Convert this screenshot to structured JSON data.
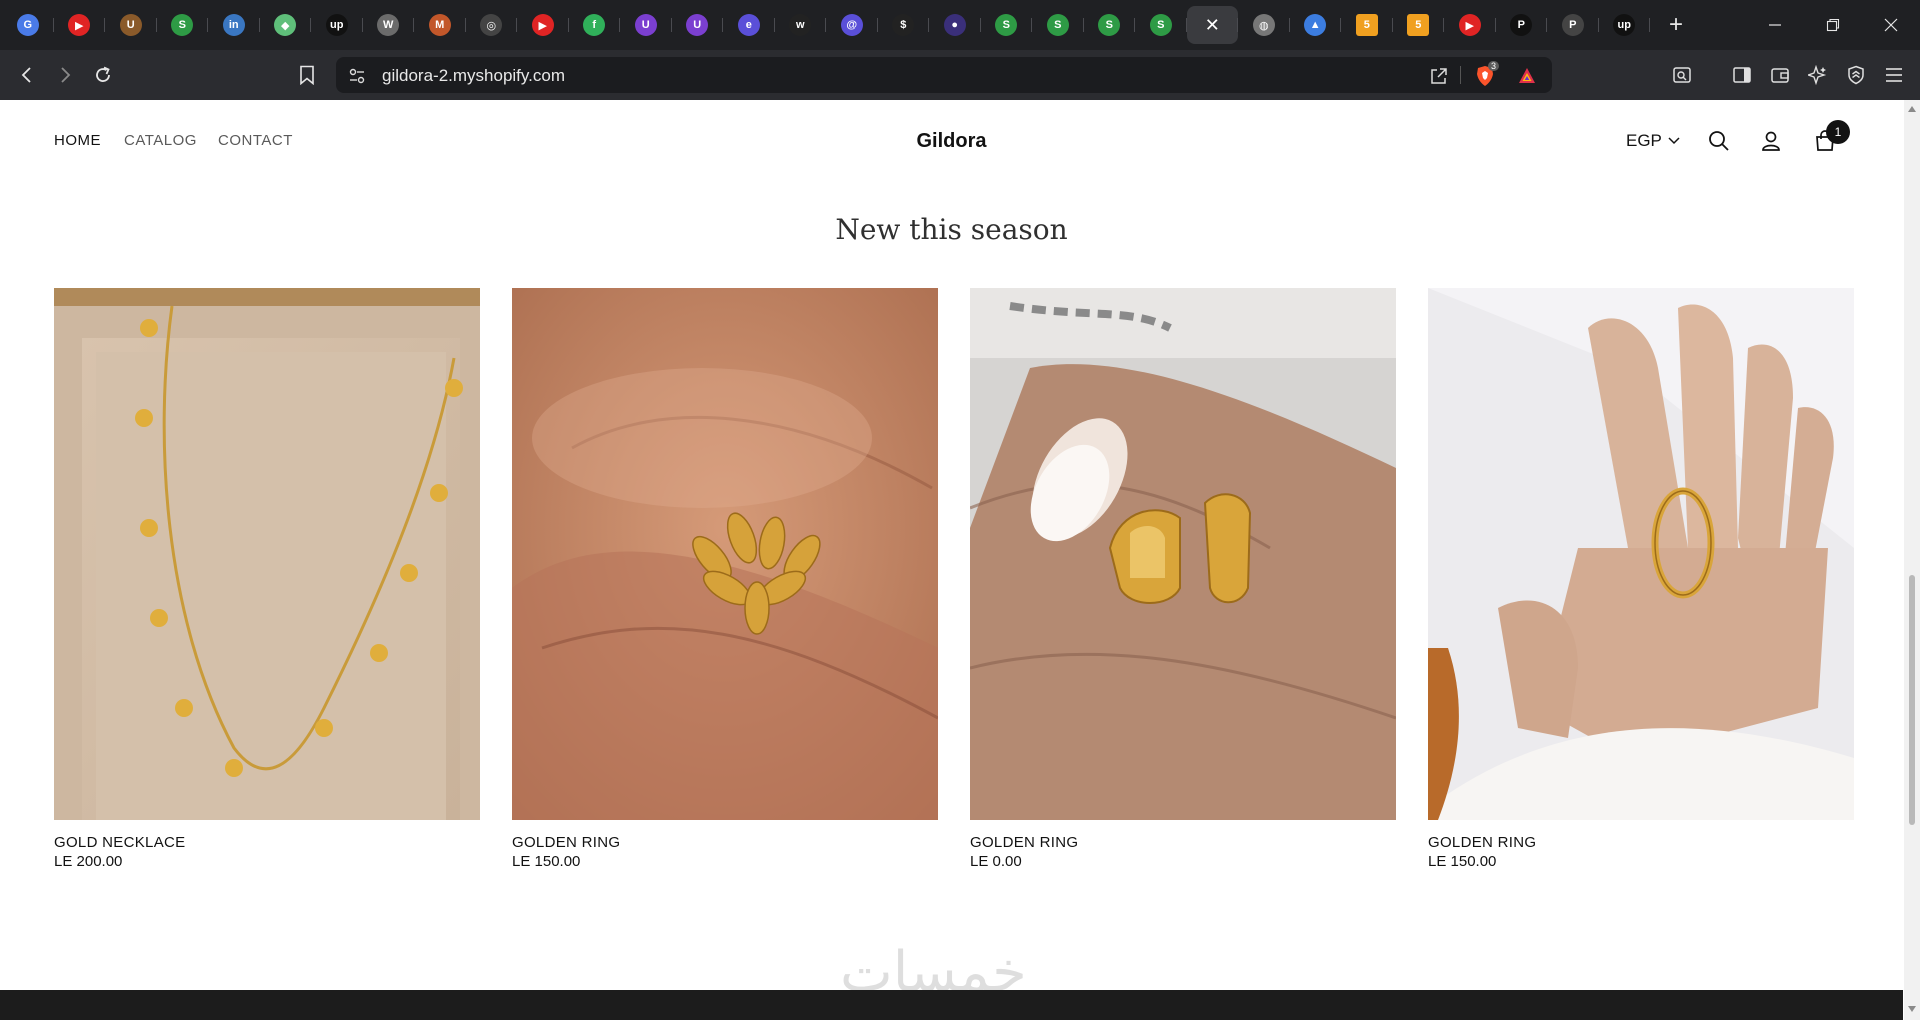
{
  "browser": {
    "tabs": [
      {
        "icon": "google-translate-icon",
        "color": "#4a7be8",
        "glyph": "G"
      },
      {
        "icon": "youtube-icon",
        "color": "#e02424",
        "glyph": "▶"
      },
      {
        "icon": "upwork-icon",
        "color": "#8a5a2a",
        "glyph": "U"
      },
      {
        "icon": "shopify-icon",
        "color": "#2e9b45",
        "glyph": "S"
      },
      {
        "icon": "linkedin-icon",
        "color": "#3a77c2",
        "glyph": "in"
      },
      {
        "icon": "green-diamond-icon",
        "color": "#5fbf7a",
        "glyph": "◆"
      },
      {
        "icon": "upwork-icon",
        "color": "#111111",
        "glyph": "up"
      },
      {
        "icon": "wordpress-icon",
        "color": "#6b6b6b",
        "glyph": "W"
      },
      {
        "icon": "magento-icon",
        "color": "#c2572a",
        "glyph": "M"
      },
      {
        "icon": "openai-icon",
        "color": "#444444",
        "glyph": "◎"
      },
      {
        "icon": "youtube-icon",
        "color": "#e02424",
        "glyph": "▶"
      },
      {
        "icon": "green-f-icon",
        "color": "#30b05a",
        "glyph": "f"
      },
      {
        "icon": "purple-u-icon",
        "color": "#7b3fd0",
        "glyph": "U"
      },
      {
        "icon": "purple-u-icon",
        "color": "#7b3fd0",
        "glyph": "U"
      },
      {
        "icon": "purple-e-icon",
        "color": "#5a4fd8",
        "glyph": "e"
      },
      {
        "icon": "webflow-icon",
        "color": "#222222",
        "glyph": "w"
      },
      {
        "icon": "purple-circle-icon",
        "color": "#5a4fd8",
        "glyph": "@"
      },
      {
        "icon": "dollar-icon",
        "color": "#222222",
        "glyph": "$"
      },
      {
        "icon": "dark-globe-icon",
        "color": "#3a2f7a",
        "glyph": "●"
      },
      {
        "icon": "shopify-icon",
        "color": "#2e9b45",
        "glyph": "S"
      },
      {
        "icon": "shopify-icon",
        "color": "#2e9b45",
        "glyph": "S"
      },
      {
        "icon": "shopify-icon",
        "color": "#2e9b45",
        "glyph": "S"
      },
      {
        "icon": "shopify-icon",
        "color": "#2e9b45",
        "glyph": "S"
      },
      {
        "icon": "close-icon",
        "color": "active",
        "glyph": "✕"
      },
      {
        "icon": "globe-icon",
        "color": "#777777",
        "glyph": "◍"
      },
      {
        "icon": "google-ads-icon",
        "color": "#3c7de0",
        "glyph": "▲"
      },
      {
        "icon": "five-icon",
        "color": "#f0a020",
        "glyph": "5"
      },
      {
        "icon": "five-icon",
        "color": "#f0a020",
        "glyph": "5"
      },
      {
        "icon": "youtube-icon",
        "color": "#e02424",
        "glyph": "▶"
      },
      {
        "icon": "p-icon",
        "color": "#111111",
        "glyph": "P"
      },
      {
        "icon": "p-icon",
        "color": "#444444",
        "glyph": "P"
      },
      {
        "icon": "upwork-icon",
        "color": "#111111",
        "glyph": "up"
      }
    ],
    "url": "gildora-2.myshopify.com",
    "brave_badge": "3"
  },
  "store": {
    "nav": [
      "HOME",
      "CATALOG",
      "CONTACT"
    ],
    "brand": "Gildora",
    "currency": "EGP",
    "cart_count": "1",
    "section_title": "New this season",
    "products": [
      {
        "title": "GOLD NECKLACE",
        "price": "LE 200.00"
      },
      {
        "title": "GOLDEN RING",
        "price": "LE 150.00"
      },
      {
        "title": "GOLDEN RING",
        "price": "LE 0.00"
      },
      {
        "title": "GOLDEN RING",
        "price": "LE 150.00"
      }
    ],
    "watermark": "خمسات"
  }
}
